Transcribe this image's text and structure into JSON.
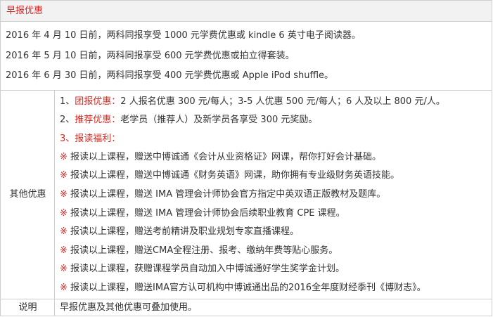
{
  "title": "早报优惠",
  "early_bird": [
    "2016 年 4 月 10 日前，两科同报享受 1000 元学费优惠或 kindle 6 英寸电子阅读器。",
    "2016 年 5 月 10 日前，两科同报享受 600 元学费优惠或拍立得套装。",
    "2016 年 6 月 30 日前，两科同报享受 400 元学费优惠或 Apple iPod shuffle。"
  ],
  "other": {
    "label": "其他优惠",
    "group_discount": {
      "prefix": "1、",
      "heading": "团报优惠：",
      "text": "2 人报名优惠 300 元/每人；3-5 人优惠 500 元/每人；6 人及以上 800 元/人。"
    },
    "referral": {
      "prefix": "2、",
      "heading": "推荐优惠：",
      "text": "老学员（推荐人）及新学员各享受 300 元奖励。"
    },
    "benefits_heading": "3、报读福利：",
    "mark": "※",
    "benefits": [
      "报读以上课程，赠送中博诚通《会计从业资格证》网课，帮你打好会计基础。",
      "报读以上课程，赠送中博诚通《财务英语》网课，助你拥有专业级财务英语技能。",
      "报读以上课程，赠送 IMA 管理会计师协会官方指定中英双语正版教材及题库。",
      "报读以上课程，赠送 IMA 管理会计师协会后续职业教育 CPE 课程。",
      "报读以上课程，赠送考前精讲及职业规划专家直播课程。",
      "报读以上课程，赠送CMA全程注册、报考、缴纳年费等贴心服务。",
      "报读以上课程，获赠课程学员自动加入中博诚通好学生奖学金计划。",
      "报读以上课程，赠送IMA官方认可机构中博诚通出品的2016全年度财经季刊《博财志》。"
    ]
  },
  "note": {
    "label": "说明",
    "text": "早报优惠及其他优惠可叠加使用。"
  }
}
